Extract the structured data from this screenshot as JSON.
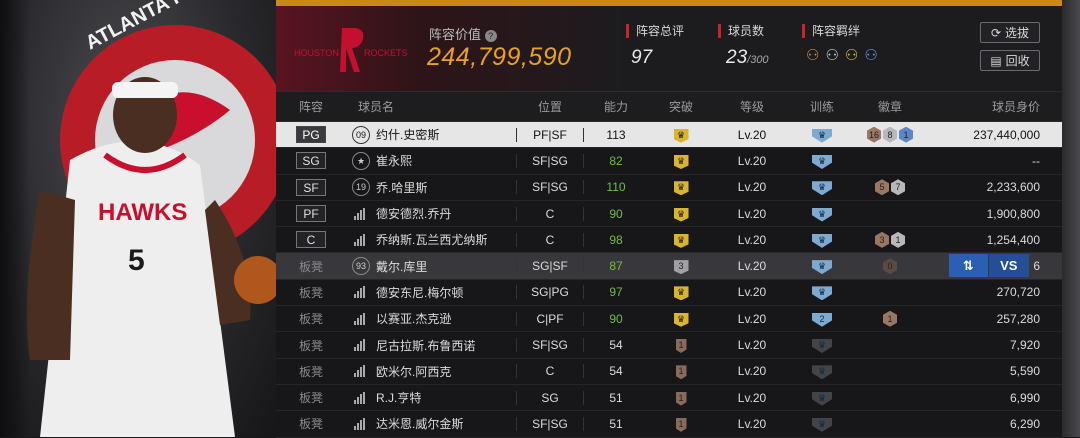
{
  "team": {
    "logo_text_left": "HOUSTON",
    "logo_text_right": "ROCKETS",
    "logo_colors": {
      "red": "#c4102e",
      "dark": "#3a0e16"
    }
  },
  "featured_player": {
    "team_logo_text": "ATLANTA HAWKS",
    "jersey_team": "HAWKS",
    "jersey_number": "5"
  },
  "header": {
    "value_label": "阵容价值",
    "value": "244,799,590",
    "rating_label": "阵容总评",
    "rating": "97",
    "count_label": "球员数",
    "count": "23",
    "count_max": "/300",
    "bond_label": "阵容羁绊",
    "buttons": {
      "select": "选拔",
      "recycle": "回收"
    }
  },
  "columns": [
    "阵容",
    "球员名",
    "位置",
    "能力",
    "突破",
    "等级",
    "训练",
    "徽章",
    "球员身价"
  ],
  "rows": [
    {
      "slot": "PG",
      "num": "09",
      "name": "约什.史密斯",
      "pos": "PF|SF",
      "ability": "113",
      "green": false,
      "breakthrough": "",
      "bk": "gold",
      "level": "Lv.20",
      "train": "",
      "tk": "blue",
      "badges": [
        {
          "n": "16",
          "k": "hx-b"
        },
        {
          "n": "8",
          "k": "hx-s"
        },
        {
          "n": "1",
          "k": "hx-bl"
        }
      ],
      "value": "237,440,000",
      "selected": true
    },
    {
      "slot": "SG",
      "num": "★",
      "name": "崔永熙",
      "pos": "SF|SG",
      "ability": "82",
      "green": true,
      "breakthrough": "",
      "bk": "gold",
      "level": "Lv.20",
      "train": "",
      "tk": "blue",
      "badges": [],
      "value": "--"
    },
    {
      "slot": "SF",
      "num": "19",
      "name": "乔.哈里斯",
      "pos": "SF|SG",
      "ability": "110",
      "green": true,
      "breakthrough": "",
      "bk": "gold",
      "level": "Lv.20",
      "train": "",
      "tk": "blue",
      "badges": [
        {
          "n": "5",
          "k": "hx-b"
        },
        {
          "n": "7",
          "k": "hx-s"
        }
      ],
      "value": "2,233,600"
    },
    {
      "slot": "PF",
      "num": "bars",
      "name": "德安德烈.乔丹",
      "pos": "C",
      "ability": "90",
      "green": true,
      "breakthrough": "",
      "bk": "gold",
      "level": "Lv.20",
      "train": "",
      "tk": "blue",
      "badges": [],
      "value": "1,900,800"
    },
    {
      "slot": "C",
      "num": "bars",
      "name": "乔纳斯.瓦兰西尤纳斯",
      "pos": "C",
      "ability": "98",
      "green": true,
      "breakthrough": "",
      "bk": "gold",
      "level": "Lv.20",
      "train": "",
      "tk": "blue",
      "badges": [
        {
          "n": "3",
          "k": "hx-b"
        },
        {
          "n": "1",
          "k": "hx-s"
        }
      ],
      "value": "1,254,400"
    },
    {
      "slot": "板凳",
      "num": "93",
      "name": "戴尔.库里",
      "pos": "SG|SF",
      "ability": "87",
      "green": true,
      "breakthrough": "3",
      "bk": "gray",
      "level": "Lv.20",
      "train": "",
      "tk": "blue",
      "badges": [
        {
          "n": "0",
          "k": "hx-d"
        }
      ],
      "value": "6",
      "highlight": true,
      "swap": true
    },
    {
      "slot": "板凳",
      "num": "bars",
      "name": "德安东尼.梅尔顿",
      "pos": "SG|PG",
      "ability": "97",
      "green": true,
      "breakthrough": "",
      "bk": "gold",
      "level": "Lv.20",
      "train": "",
      "tk": "blue",
      "badges": [],
      "value": "270,720"
    },
    {
      "slot": "板凳",
      "num": "bars",
      "name": "以赛亚.杰克逊",
      "pos": "C|PF",
      "ability": "90",
      "green": true,
      "breakthrough": "",
      "bk": "gold",
      "level": "Lv.20",
      "train": "2",
      "tk": "blue",
      "badges": [
        {
          "n": "1",
          "k": "hx-b"
        }
      ],
      "value": "257,280"
    },
    {
      "slot": "板凳",
      "num": "bars",
      "name": "尼古拉斯.布鲁西诺",
      "pos": "SF|SG",
      "ability": "54",
      "green": false,
      "breakthrough": "1",
      "bk": "brown",
      "level": "Lv.20",
      "train": "",
      "tk": "dark",
      "badges": [],
      "value": "7,920"
    },
    {
      "slot": "板凳",
      "num": "bars",
      "name": "欧米尔.阿西克",
      "pos": "C",
      "ability": "54",
      "green": false,
      "breakthrough": "1",
      "bk": "brown",
      "level": "Lv.20",
      "train": "",
      "tk": "dark",
      "badges": [],
      "value": "5,590"
    },
    {
      "slot": "板凳",
      "num": "bars",
      "name": "R.J.亨特",
      "pos": "SG",
      "ability": "51",
      "green": false,
      "breakthrough": "1",
      "bk": "brown",
      "level": "Lv.20",
      "train": "",
      "tk": "dark",
      "badges": [],
      "value": "6,990"
    },
    {
      "slot": "板凳",
      "num": "bars",
      "name": "达米恩.威尔金斯",
      "pos": "SF|SG",
      "ability": "51",
      "green": false,
      "breakthrough": "1",
      "bk": "brown",
      "level": "Lv.20",
      "train": "",
      "tk": "dark",
      "badges": [],
      "value": "6,290"
    }
  ],
  "swap": {
    "left": "⇅",
    "right": "VS"
  }
}
